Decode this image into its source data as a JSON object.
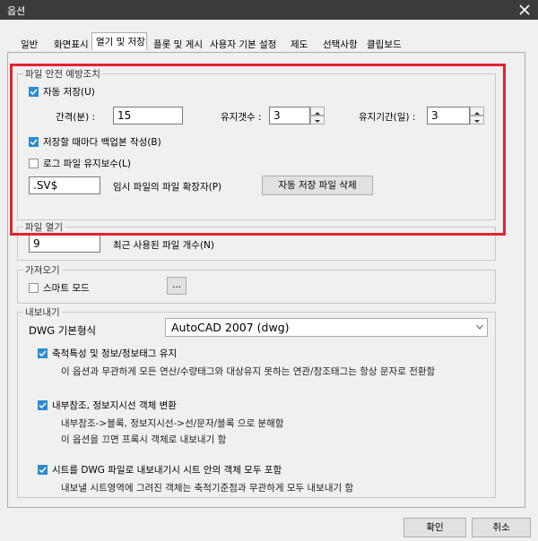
{
  "window": {
    "title": "옵션",
    "close_icon": "close-icon"
  },
  "tabs": [
    {
      "label": "일반"
    },
    {
      "label": "화면표시"
    },
    {
      "label": "열기 및 저장"
    },
    {
      "label": "플롯 및 게시"
    },
    {
      "label": "사용자 기본 설정"
    },
    {
      "label": "제도"
    },
    {
      "label": "선택사항"
    },
    {
      "label": "클립보드"
    }
  ],
  "active_tab": "열기 및 저장",
  "file_safety": {
    "title": "파일 안전 예방조치",
    "autosave": {
      "label": "자동 저장(U)",
      "checked": true
    },
    "interval": {
      "label": "간격(분) :",
      "value": "15"
    },
    "keep_count": {
      "label": "유지갯수 :",
      "value": "3"
    },
    "keep_period": {
      "label": "유지기간(일) :",
      "value": "3"
    },
    "backup": {
      "label": "저장할 때마다 백업본 작성(B)",
      "checked": true
    },
    "log": {
      "label": "로그 파일 유지보수(L)",
      "checked": false
    },
    "extension": {
      "value": ".SV$",
      "label": "임시 파일의 파일 확장자(P)"
    },
    "delete_button": "자동 저장 파일 삭제"
  },
  "file_open": {
    "title": "파일 열기",
    "recent_count": {
      "value": "9",
      "label": "최근 사용된 파일 개수(N)"
    }
  },
  "import": {
    "title": "가져오기",
    "smart_mode": {
      "label": "스마트 모드",
      "checked": false
    },
    "browse_button": "..."
  },
  "export": {
    "title": "내보내기",
    "dwg_format_label": "DWG 기본형식",
    "dwg_format_value": "AutoCAD 2007 (dwg)",
    "opt1": {
      "label": "축척특성 및 정보/정보태그 유지",
      "checked": true,
      "desc": "이 옵션과 무관하게 모든 연산/수량태그와 대상유지 못하는 연관/참조태그는 항상 문자로 전환함"
    },
    "opt2": {
      "label": "내부참조, 정보지시선 객체 변환",
      "checked": true,
      "desc1": "내부참조->블록, 정보지시선->선/문자/블록 으로 분해함",
      "desc2": "이 옵션을 끄면 프록시 객체로 내보내기 함"
    },
    "opt3": {
      "label": "시트를 DWG 파일로 내보내기시 시트 안의 객체 모두 포함",
      "checked": true,
      "desc": "내보낼 시트영역에 그려진 객체는 축척기준점과 무관하게 모두 내보내기 함"
    }
  },
  "footer": {
    "ok": "확인",
    "cancel": "취소"
  }
}
